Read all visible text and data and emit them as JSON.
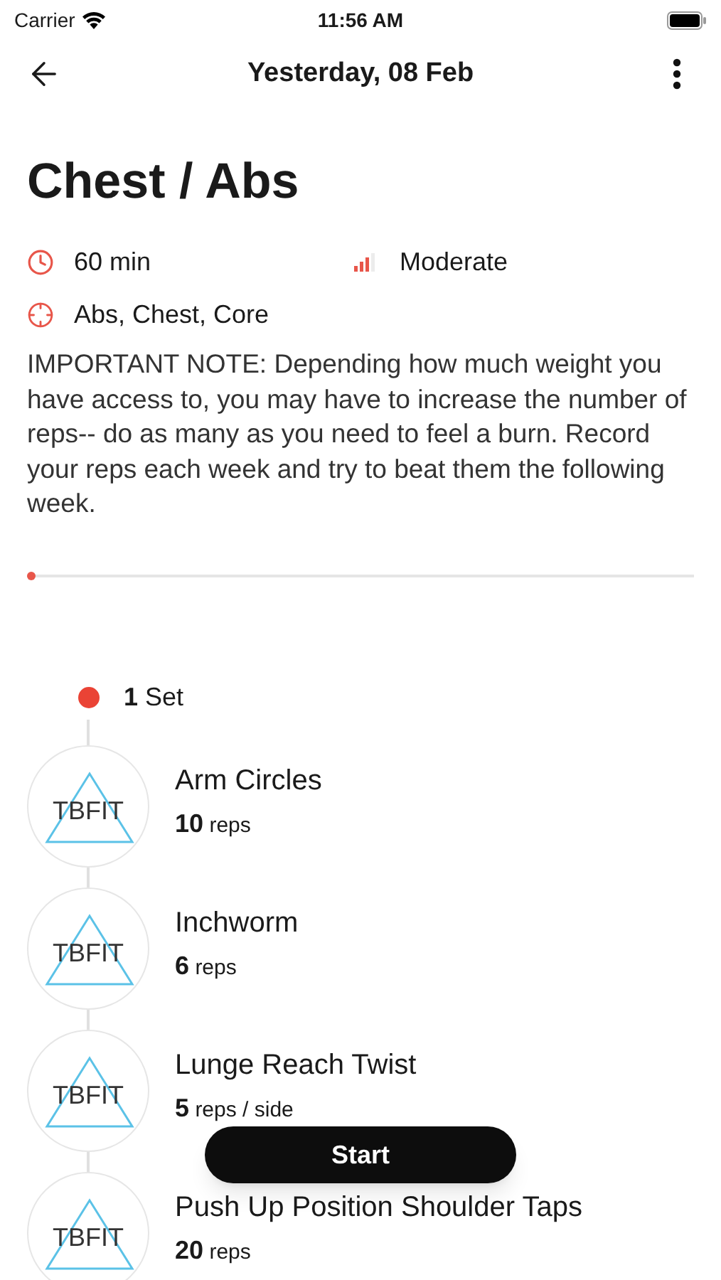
{
  "status_bar": {
    "carrier": "Carrier",
    "time": "11:56 AM"
  },
  "header": {
    "title": "Yesterday, 08 Feb"
  },
  "workout": {
    "title": "Chest / Abs",
    "duration": "60 min",
    "difficulty": {
      "text": "Moderate",
      "level": 0.75
    },
    "muscles": "Abs, Chest, Core",
    "note": "IMPORTANT NOTE: Depending how much weight you have access to, you may have to increase the number of reps-- do as many as you need to feel a burn. Record your reps each week and try to beat them the following week."
  },
  "progress": {
    "level": 0
  },
  "set": {
    "count": "1",
    "label": "Set"
  },
  "exercises": [
    {
      "logo": "TBFIT",
      "name": "Arm Circles",
      "count": "10",
      "unit": "reps"
    },
    {
      "logo": "TBFIT",
      "name": "Inchworm",
      "count": "6",
      "unit": "reps"
    },
    {
      "logo": "TBFIT",
      "name": "Lunge Reach Twist",
      "count": "5",
      "unit": "reps / side"
    },
    {
      "logo": "TBFIT",
      "name": "Push Up Position Shoulder Taps",
      "count": "20",
      "unit": "reps"
    }
  ],
  "start_button": "Start"
}
